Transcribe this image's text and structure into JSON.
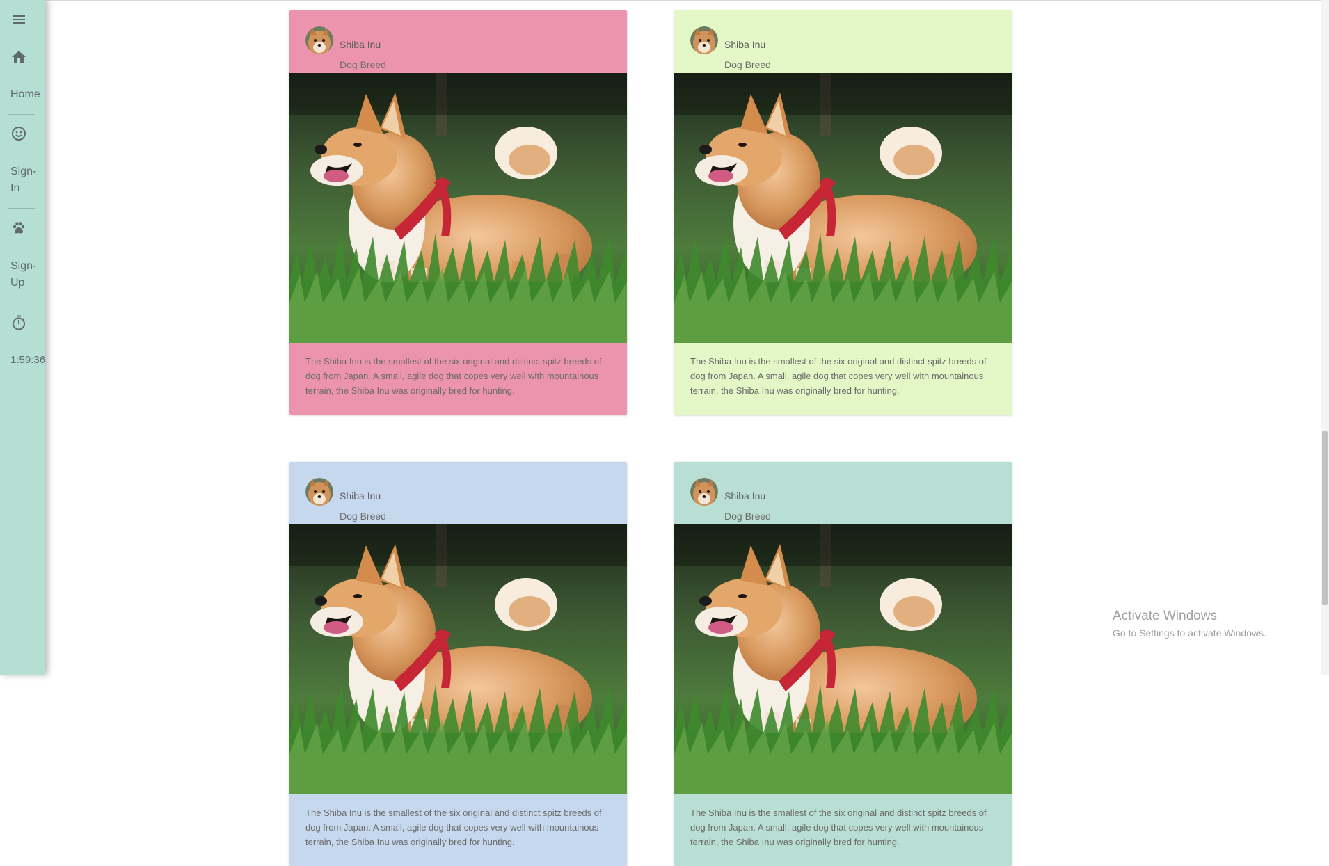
{
  "sidebar": {
    "menu_icon": "hamburger-menu-icon",
    "items": [
      {
        "icon": "home-icon",
        "label": "Home"
      },
      {
        "icon": "smiley-face-icon",
        "label": "Sign-\nIn"
      },
      {
        "icon": "paw-icon",
        "label": "Sign-\nUp"
      },
      {
        "icon": "stopwatch-icon",
        "label": "1:59:36"
      }
    ],
    "color": "#b6dfd3"
  },
  "cards": [
    {
      "title": "Shiba Inu",
      "subtitle": "Dog Breed",
      "description": "The Shiba Inu is the smallest of the six original and distinct spitz breeds of dog from Japan. A small, agile dog that copes very well with mountainous terrain, the Shiba Inu was originally bred for hunting.",
      "color": "#ec94ae"
    },
    {
      "title": "Shiba Inu",
      "subtitle": "Dog Breed",
      "description": "The Shiba Inu is the smallest of the six original and distinct spitz breeds of dog from Japan. A small, agile dog that copes very well with mountainous terrain, the Shiba Inu was originally bred for hunting.",
      "color": "#e3f8c6"
    },
    {
      "title": "Shiba Inu",
      "subtitle": "Dog Breed",
      "description": "The Shiba Inu is the smallest of the six original and distinct spitz breeds of dog from Japan. A small, agile dog that copes very well with mountainous terrain, the Shiba Inu was originally bred for hunting.",
      "color": "#c6d8ed"
    },
    {
      "title": "Shiba Inu",
      "subtitle": "Dog Breed",
      "description": "The Shiba Inu is the smallest of the six original and distinct spitz breeds of dog from Japan. A small, agile dog that copes very well with mountainous terrain, the Shiba Inu was originally bred for hunting.",
      "color": "#b9ded3"
    }
  ],
  "watermark": {
    "title": "Activate Windows",
    "subtitle": "Go to Settings to activate Windows."
  }
}
